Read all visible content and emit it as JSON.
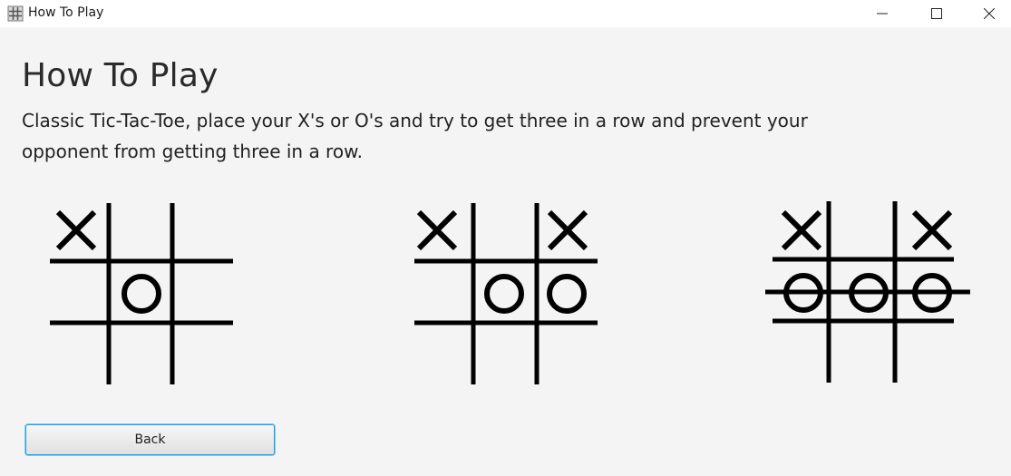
{
  "window": {
    "title": "How To Play",
    "app_icon": "game-icon"
  },
  "title_bar_controls": [
    "minimize-icon",
    "maximize-icon",
    "close-icon"
  ],
  "page": {
    "heading": "How To Play",
    "description": "Classic Tic-Tac-Toe, place your X's or O's and try to get three in a row and prevent your opponent from getting three in a row."
  },
  "boards": [
    {
      "name": "board-step-1",
      "cells": [
        "X",
        "",
        "",
        "",
        "O",
        "",
        "",
        "",
        ""
      ],
      "win_line": null
    },
    {
      "name": "board-step-2",
      "cells": [
        "X",
        "",
        "X",
        "",
        "O",
        "O",
        "",
        "",
        ""
      ],
      "win_line": null
    },
    {
      "name": "board-step-3",
      "cells": [
        "X",
        "",
        "X",
        "O",
        "O",
        "O",
        "",
        "",
        ""
      ],
      "win_line": "middle-row"
    }
  ],
  "back_button": {
    "label": "Back"
  },
  "colors": {
    "background": "#f4f4f4",
    "titlebar": "#ffffff",
    "ink": "#000000",
    "button_focus_border": "#1ea0e6"
  }
}
